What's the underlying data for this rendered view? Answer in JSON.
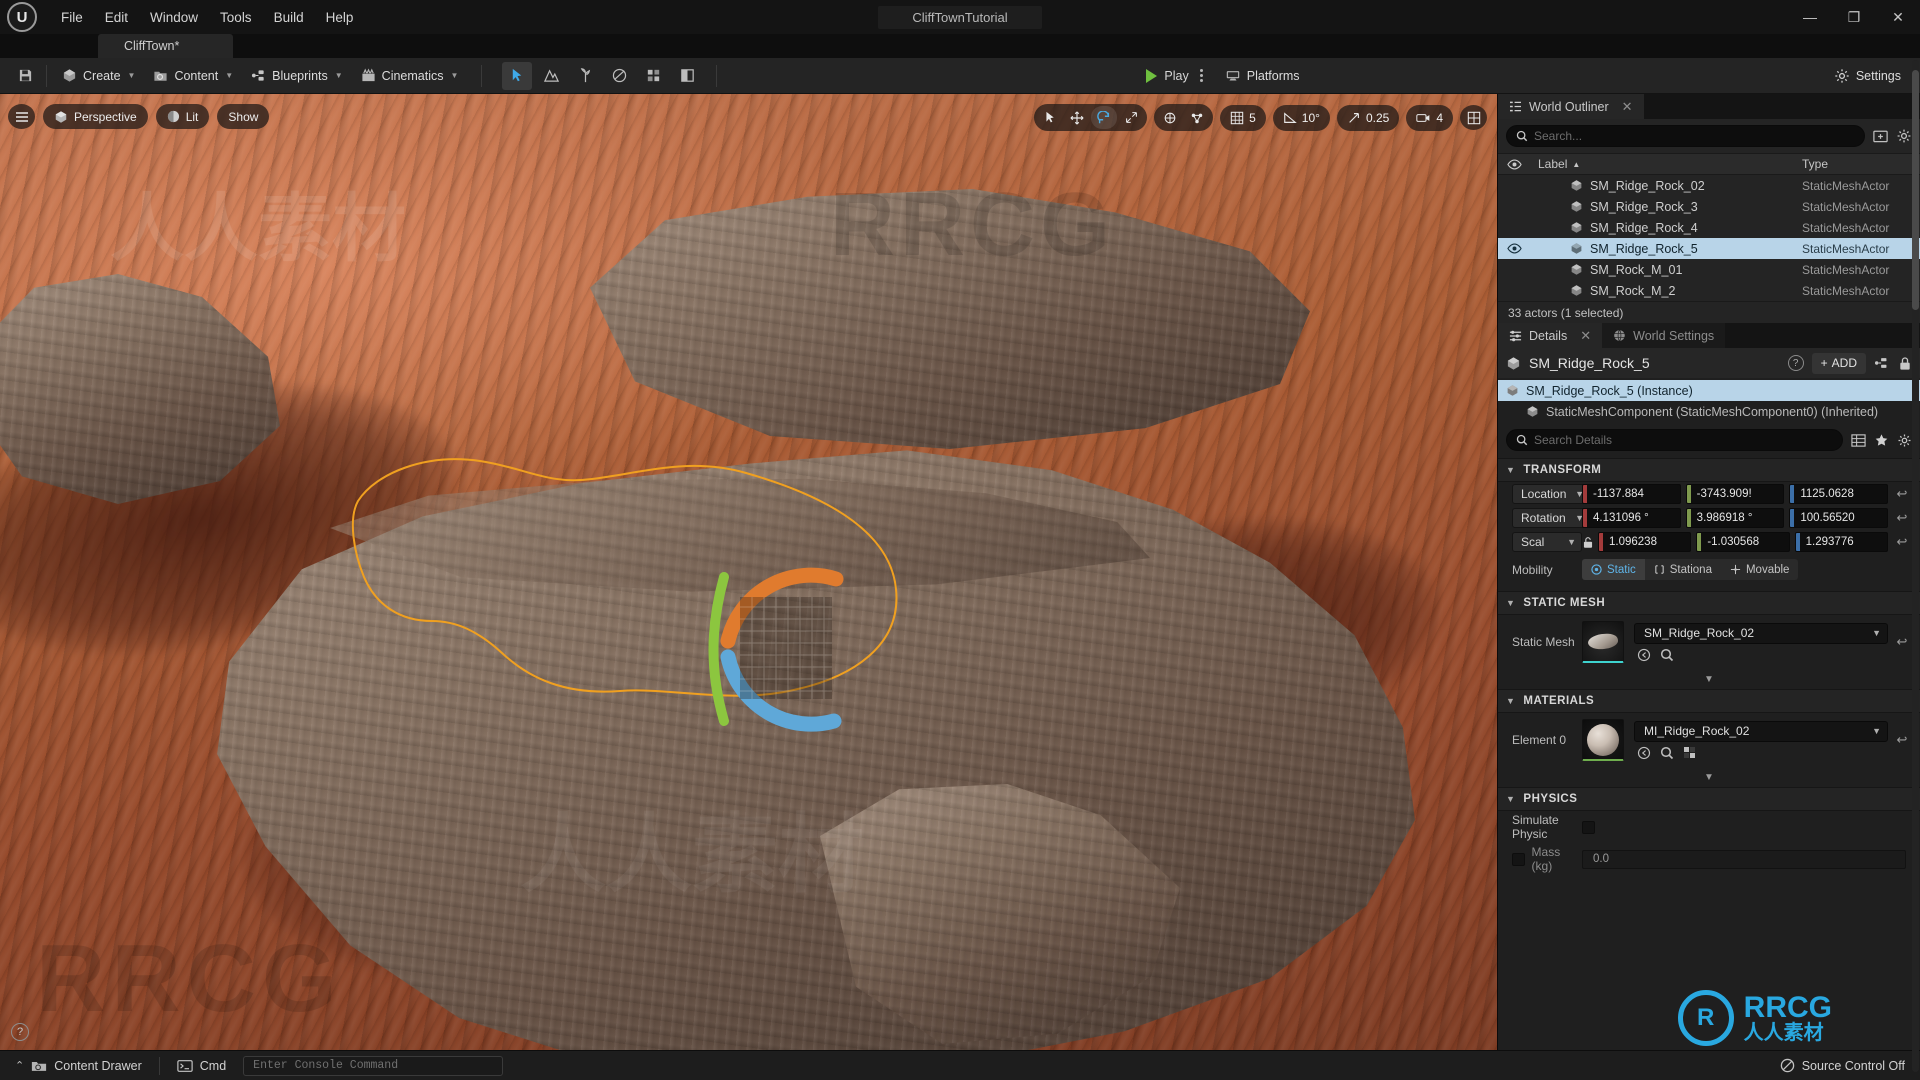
{
  "window": {
    "title": "CliffTownTutorial",
    "minimize": "—",
    "maximize": "❐",
    "close": "✕",
    "logo": "unreal-engine-logo"
  },
  "menubar": {
    "items": [
      "File",
      "Edit",
      "Window",
      "Tools",
      "Build",
      "Help"
    ]
  },
  "level_tab": {
    "label": "CliffTown*"
  },
  "toolbar": {
    "save_icon": "save-icon",
    "buttons": [
      {
        "label": "Create",
        "icon": "create-icon"
      },
      {
        "label": "Content",
        "icon": "content-icon"
      },
      {
        "label": "Blueprints",
        "icon": "blueprints-icon"
      },
      {
        "label": "Cinematics",
        "icon": "cinematics-icon"
      }
    ],
    "mode_icons": [
      "select-mode-icon",
      "landscape-mode-icon",
      "foliage-mode-icon",
      "mesh-paint-mode-icon",
      "fracture-mode-icon",
      "brush-edit-mode-icon"
    ],
    "play_label": "Play",
    "platforms_label": "Platforms",
    "settings_label": "Settings"
  },
  "viewport": {
    "menu_icon": "viewport-menu-icon",
    "view_mode": "Perspective",
    "lighting_mode": "Lit",
    "show_label": "Show",
    "gizmos": [
      "select-tool-icon",
      "move-tool-icon",
      "rotate-tool-icon",
      "scale-tool-icon"
    ],
    "active_gizmo": "rotate-tool-icon",
    "coordinate_icon": "world-space-icon",
    "surface_snap_icon": "surface-snap-icon",
    "grid_snap_value": "5",
    "angle_snap_value": "10°",
    "scale_snap_value": "0.25",
    "camera_speed_value": "4",
    "layout_icon": "viewport-layout-icon",
    "help_icon": "?"
  },
  "world_outliner": {
    "tab_label": "World Outliner",
    "close_icon": "✕",
    "search_placeholder": "Search...",
    "columns": {
      "eye": "visibility-icon",
      "label": "Label",
      "sort": "▲",
      "type": "Type"
    },
    "rows": [
      {
        "name": "SM_Ridge_Rock_02",
        "type": "StaticMeshActor",
        "selected": false,
        "visible": false
      },
      {
        "name": "SM_Ridge_Rock_3",
        "type": "StaticMeshActor",
        "selected": false,
        "visible": false
      },
      {
        "name": "SM_Ridge_Rock_4",
        "type": "StaticMeshActor",
        "selected": false,
        "visible": false
      },
      {
        "name": "SM_Ridge_Rock_5",
        "type": "StaticMeshActor",
        "selected": true,
        "visible": true
      },
      {
        "name": "SM_Rock_M_01",
        "type": "StaticMeshActor",
        "selected": false,
        "visible": false
      },
      {
        "name": "SM_Rock_M_2",
        "type": "StaticMeshActor",
        "selected": false,
        "visible": false
      }
    ],
    "status": "33 actors (1 selected)"
  },
  "details": {
    "tabs": [
      {
        "label": "Details",
        "icon": "details-icon",
        "active": true,
        "close": "✕"
      },
      {
        "label": "World Settings",
        "icon": "world-settings-icon",
        "active": false
      }
    ],
    "actor_name": "SM_Ridge_Rock_5",
    "help_icon": "?",
    "add_label": "ADD",
    "add_plus": "+",
    "blueprint_icon": "blueprint-icon",
    "lock_icon": "lock-icon",
    "tree": [
      {
        "label": "SM_Ridge_Rock_5 (Instance)",
        "selected": true,
        "child": false
      },
      {
        "label": "StaticMeshComponent (StaticMeshComponent0) (Inherited)",
        "selected": false,
        "child": true
      }
    ],
    "search_placeholder": "Search Details",
    "search_icons": [
      "column-view-icon",
      "favorites-star-icon",
      "settings-gear-icon"
    ],
    "sections": {
      "transform": {
        "title": "TRANSFORM",
        "rows": [
          {
            "label": "Location",
            "x": "-1137.884",
            "y": "-3743.909!",
            "z": "1125.0628"
          },
          {
            "label": "Rotation",
            "x": "4.131096 °",
            "y": "3.986918 °",
            "z": "100.56520"
          },
          {
            "label": "Scal",
            "x": "1.096238",
            "y": "-1.030568",
            "z": "1.293776"
          }
        ],
        "reset_icon": "↩",
        "lock_icon": "lock-icon",
        "mobility_label": "Mobility",
        "mobility_options": [
          "Static",
          "Stationa",
          "Movable"
        ],
        "mobility_selected": "Static"
      },
      "static_mesh": {
        "title": "STATIC MESH",
        "label": "Static Mesh",
        "value": "SM_Ridge_Rock_02",
        "icons": [
          "browse-to-asset-icon",
          "search-asset-icon"
        ],
        "reset_icon": "↩"
      },
      "materials": {
        "title": "MATERIALS",
        "label": "Element 0",
        "value": "MI_Ridge_Rock_02",
        "icons": [
          "browse-to-asset-icon",
          "search-asset-icon",
          "checker-material-icon"
        ],
        "reset_icon": "↩"
      },
      "physics": {
        "title": "PHYSICS",
        "simulate_label": "Simulate Physic",
        "simulate_checked": false,
        "mass_label": "Mass (kg)",
        "mass_value": "0.0",
        "mass_checked": false
      }
    }
  },
  "statusbar": {
    "content_drawer_label": "Content Drawer",
    "content_drawer_caret": "⌃",
    "cmd_label": "Cmd",
    "console_placeholder": "Enter Console Command",
    "source_control_label": "Source Control Off",
    "source_control_icon": "source-control-off-icon"
  },
  "watermarks": {
    "rrcg": "RRCG",
    "cn": "人人素材"
  },
  "colors": {
    "accent_blue": "#29a8e0",
    "selection_blue": "#b8d4e8",
    "play_green": "#6fbf3f",
    "axis_x": "#a33b3b",
    "axis_y": "#7f9a4e",
    "axis_z": "#3c6fa8",
    "outline_orange": "#f0a020",
    "panel_bg": "#1f1f1f"
  }
}
